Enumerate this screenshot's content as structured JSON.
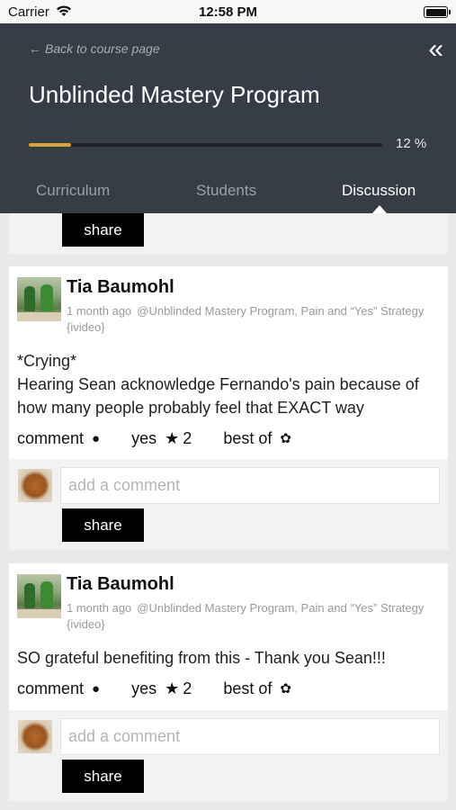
{
  "status_bar": {
    "carrier": "Carrier",
    "time": "12:58 PM"
  },
  "header": {
    "back_label": "Back to course page",
    "title": "Unblinded Mastery Program",
    "progress": {
      "percent": 12,
      "label": "12 %"
    },
    "collapse_glyph": "«",
    "accent_color": "#d8a330",
    "background_color": "#363d47"
  },
  "tabs": [
    {
      "label": "Curriculum",
      "active": false
    },
    {
      "label": "Students",
      "active": false
    },
    {
      "label": "Discussion",
      "active": true
    }
  ],
  "share_label": "share",
  "comment_placeholder": "add a comment",
  "posts": [
    {
      "author": "Tia Baumohl",
      "time": "1 month ago",
      "context": "@Unblinded Mastery Program, Pain and “Yes” Strategy {ivideo}",
      "body_line1": "*Crying*",
      "body_line2": "Hearing Sean acknowledge Fernando's pain because of how many people probably feel that EXACT way",
      "comment_label": "comment",
      "yes_label": "yes",
      "yes_count": "2",
      "best_label": "best of"
    },
    {
      "author": "Tia Baumohl",
      "time": "1 month ago",
      "context": "@Unblinded Mastery Program, Pain and “Yes” Strategy {ivideo}",
      "body": "SO grateful benefiting from this - Thank you Sean!!!",
      "comment_label": "comment",
      "yes_label": "yes",
      "yes_count": "2",
      "best_label": "best of"
    }
  ],
  "icons": {
    "comment": "comment-bubble-icon",
    "yes": "star-icon",
    "best": "ribbon-award-icon",
    "back": "arrow-left-icon",
    "collapse": "double-chevron-left-icon"
  }
}
